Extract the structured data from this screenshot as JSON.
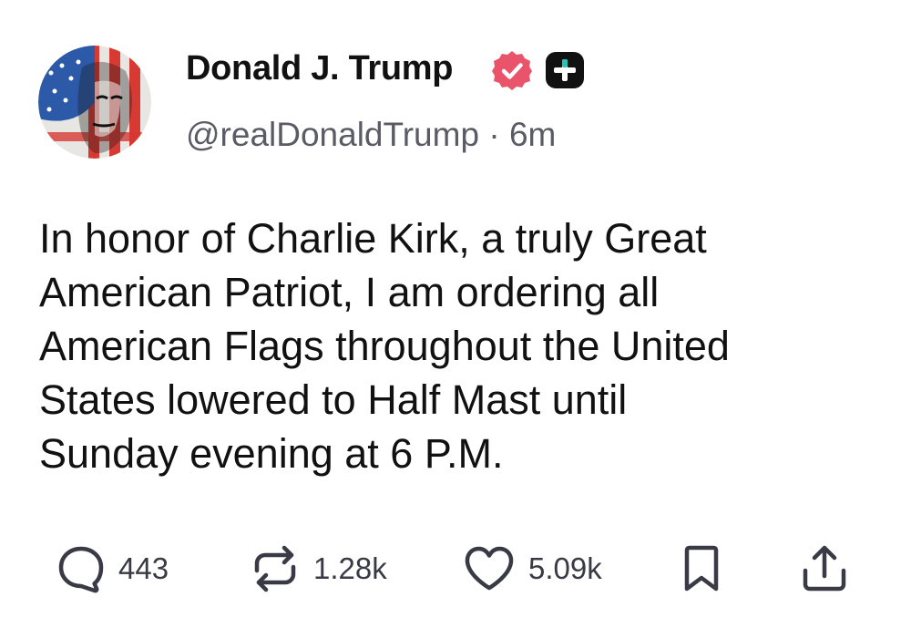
{
  "post": {
    "author": {
      "name": "Donald J. Trump",
      "handle": "@realDonaldTrump",
      "separator": "·",
      "time": "6m",
      "avatar_icon": "avatar-flag-portrait",
      "verified_icon": "verified-badge-icon",
      "verified_color": "#e9546b",
      "plus_badge_icon": "plus-badge-icon",
      "plus_badge_color": "#111111",
      "plus_badge_accent": "#24c4b4"
    },
    "body_lines": [
      "In honor of Charlie Kirk, a truly Great",
      "American Patriot, I am ordering all",
      "American Flags throughout the United",
      "States lowered to Half Mast until",
      "Sunday evening at 6 P.M."
    ],
    "actions": {
      "reply": {
        "icon": "speech-bubble-icon",
        "count": "443"
      },
      "repost": {
        "icon": "repost-arrows-icon",
        "count": "1.28k"
      },
      "like": {
        "icon": "heart-icon",
        "count": "5.09k"
      },
      "bookmark": {
        "icon": "bookmark-icon"
      },
      "share": {
        "icon": "share-upload-icon"
      }
    },
    "colors": {
      "text": "#111111",
      "muted": "#5b5b66",
      "icon": "#3a3a46"
    }
  }
}
